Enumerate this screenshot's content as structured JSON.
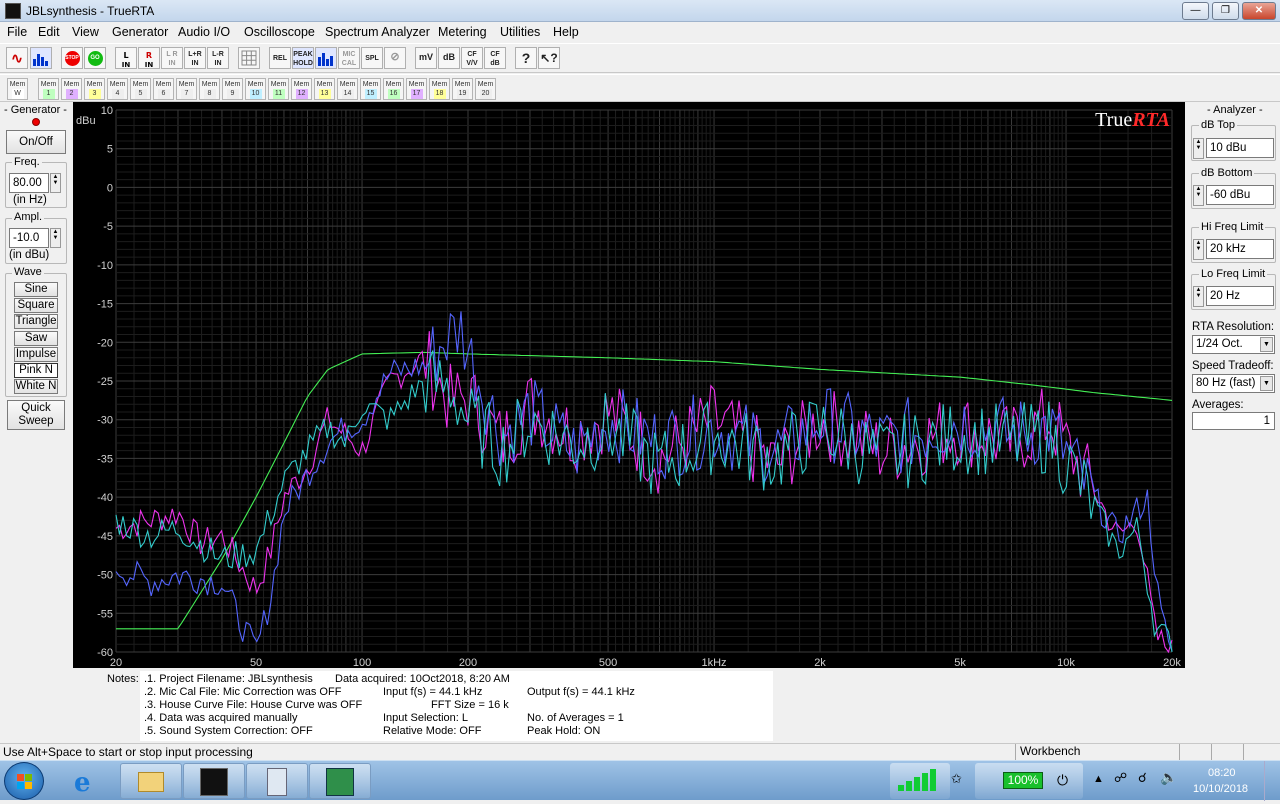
{
  "window": {
    "title": "JBLsynthesis - TrueRTA"
  },
  "menu": [
    "File",
    "Edit",
    "View",
    "Generator",
    "Audio I/O",
    "Oscilloscope",
    "Spectrum Analyzer",
    "Metering",
    "Utilities",
    "Help"
  ],
  "toolbar": {
    "buttons": [
      "L\nIN",
      "R\nIN",
      "L\nIN",
      "L+R\nIN",
      "L-R\nIN",
      "REL",
      "PEAK\nHOLD",
      "MIC\nCAL",
      "SPL",
      "mV",
      "dB",
      "CF\nV/V",
      "CF\ndB",
      "?"
    ],
    "mem_labels": [
      "W",
      "1",
      "2",
      "3",
      "4",
      "5",
      "6",
      "7",
      "8",
      "9",
      "10",
      "11",
      "12",
      "13",
      "14",
      "15",
      "16",
      "17",
      "18",
      "19",
      "20"
    ],
    "mem_prefix": "Mem"
  },
  "generator": {
    "title": "- Generator -",
    "onoff": "On/Off",
    "freq_title": "Freq.",
    "freq_value": "80.00",
    "freq_unit": "(in Hz)",
    "ampl_title": "Ampl.",
    "ampl_value": "-10.0",
    "ampl_unit": "(in dBu)",
    "wave_title": "Wave",
    "waves": [
      "Sine",
      "Square",
      "Triangle",
      "Saw",
      "Impulse",
      "Pink N",
      "White N"
    ],
    "quick_sweep": [
      "Quick",
      "Sweep"
    ]
  },
  "analyzer": {
    "title": "- Analyzer -",
    "db_top_title": "dB Top",
    "db_top": "10 dBu",
    "db_bottom_title": "dB Bottom",
    "db_bottom": "-60 dBu",
    "hi_title": "Hi Freq Limit",
    "hi": "20 kHz",
    "lo_title": "Lo Freq Limit",
    "lo": "20 Hz",
    "res_title": "RTA Resolution:",
    "res": "1/24 Oct.",
    "speed_title": "Speed Tradeoff:",
    "speed": "80 Hz (fast)",
    "avg_title": "Averages:",
    "avg": "1"
  },
  "chart_data": {
    "type": "line",
    "logo": {
      "a": "True",
      "b": "RTA"
    },
    "ylabel": "dBu",
    "ylim": [
      -60,
      10
    ],
    "xlim": [
      20,
      20000
    ],
    "x_scale": "log",
    "grid": true,
    "yticks": [
      "10",
      "5",
      "0",
      "-5",
      "-10",
      "-15",
      "-20",
      "-25",
      "-30",
      "-35",
      "-40",
      "-45",
      "-50",
      "-55",
      "-60"
    ],
    "xticks": [
      {
        "v": 20,
        "t": "20"
      },
      {
        "v": 50,
        "t": "50"
      },
      {
        "v": 100,
        "t": "100"
      },
      {
        "v": 200,
        "t": "200"
      },
      {
        "v": 500,
        "t": "500"
      },
      {
        "v": 1000,
        "t": "1kHz"
      },
      {
        "v": 2000,
        "t": "2k"
      },
      {
        "v": 5000,
        "t": "5k"
      },
      {
        "v": 10000,
        "t": "10k"
      },
      {
        "v": 20000,
        "t": "20k"
      }
    ],
    "series": [
      {
        "color": "#44ee55",
        "smooth": true,
        "points": [
          [
            20,
            -57
          ],
          [
            30,
            -57
          ],
          [
            40,
            -48
          ],
          [
            50,
            -40
          ],
          [
            60,
            -33
          ],
          [
            70,
            -27
          ],
          [
            80,
            -23.5
          ],
          [
            100,
            -21.5
          ],
          [
            150,
            -21.3
          ],
          [
            200,
            -21.5
          ],
          [
            500,
            -22
          ],
          [
            1000,
            -22.5
          ],
          [
            2000,
            -23.5
          ],
          [
            5000,
            -24.5
          ],
          [
            8000,
            -25.5
          ],
          [
            12000,
            -26.5
          ],
          [
            20000,
            -27.5
          ]
        ]
      },
      {
        "color": "#ee33ee",
        "smooth": false,
        "points": [
          [
            20,
            -44
          ],
          [
            25,
            -43
          ],
          [
            30,
            -42
          ],
          [
            35,
            -46
          ],
          [
            40,
            -45
          ],
          [
            50,
            -52
          ],
          [
            55,
            -47
          ],
          [
            60,
            -40
          ],
          [
            70,
            -36
          ],
          [
            80,
            -30
          ],
          [
            90,
            -32
          ],
          [
            100,
            -34
          ],
          [
            120,
            -25
          ],
          [
            150,
            -22
          ],
          [
            180,
            -28
          ],
          [
            200,
            -27
          ],
          [
            250,
            -33
          ],
          [
            300,
            -28
          ],
          [
            400,
            -32
          ],
          [
            500,
            -29
          ],
          [
            700,
            -35
          ],
          [
            1000,
            -30
          ],
          [
            1500,
            -36
          ],
          [
            2000,
            -30
          ],
          [
            3000,
            -34
          ],
          [
            5000,
            -31
          ],
          [
            7000,
            -33
          ],
          [
            9000,
            -30
          ],
          [
            12000,
            -39
          ],
          [
            14000,
            -45
          ],
          [
            16000,
            -43
          ],
          [
            18000,
            -58
          ],
          [
            20000,
            -60
          ]
        ]
      },
      {
        "color": "#5566ff",
        "smooth": false,
        "points": [
          [
            20,
            -49
          ],
          [
            25,
            -51
          ],
          [
            30,
            -50
          ],
          [
            40,
            -51
          ],
          [
            45,
            -56
          ],
          [
            50,
            -60
          ],
          [
            55,
            -53
          ],
          [
            60,
            -42
          ],
          [
            70,
            -37
          ],
          [
            80,
            -33
          ],
          [
            90,
            -31
          ],
          [
            100,
            -30
          ],
          [
            120,
            -24
          ],
          [
            150,
            -23
          ],
          [
            170,
            -20
          ],
          [
            190,
            -18
          ],
          [
            220,
            -26
          ],
          [
            250,
            -32
          ],
          [
            300,
            -29
          ],
          [
            400,
            -34
          ],
          [
            500,
            -30
          ],
          [
            700,
            -33
          ],
          [
            1000,
            -31
          ],
          [
            1500,
            -34
          ],
          [
            2000,
            -30
          ],
          [
            3000,
            -33
          ],
          [
            5000,
            -30
          ],
          [
            7000,
            -32
          ],
          [
            9000,
            -31
          ],
          [
            12000,
            -40
          ],
          [
            14000,
            -45
          ],
          [
            17000,
            -40
          ],
          [
            18500,
            -55
          ],
          [
            20000,
            -60
          ]
        ]
      },
      {
        "color": "#33cccc",
        "smooth": false,
        "points": [
          [
            20,
            -43
          ],
          [
            25,
            -45
          ],
          [
            30,
            -44
          ],
          [
            40,
            -48
          ],
          [
            50,
            -47
          ],
          [
            60,
            -38
          ],
          [
            70,
            -34
          ],
          [
            80,
            -31
          ],
          [
            90,
            -33
          ],
          [
            100,
            -28
          ],
          [
            120,
            -30
          ],
          [
            150,
            -25
          ],
          [
            180,
            -26
          ],
          [
            200,
            -30
          ],
          [
            250,
            -34
          ],
          [
            300,
            -30
          ],
          [
            400,
            -33
          ],
          [
            500,
            -31
          ],
          [
            700,
            -36
          ],
          [
            1000,
            -32
          ],
          [
            1500,
            -35
          ],
          [
            2000,
            -31
          ],
          [
            3000,
            -35
          ],
          [
            5000,
            -32
          ],
          [
            7000,
            -33
          ],
          [
            9000,
            -32
          ],
          [
            12000,
            -41
          ],
          [
            14000,
            -47
          ],
          [
            16000,
            -44
          ],
          [
            18000,
            -57
          ],
          [
            20000,
            -59
          ]
        ]
      }
    ]
  },
  "notes": {
    "label": "Notes:",
    "lines": [
      ".1. Project Filename: JBLsynthesis",
      ".2. Mic Cal File: Mic Correction was OFF",
      ".3. House Curve File: House Curve was OFF",
      ".4. Data was acquired manually",
      ".5. Sound System Correction: OFF"
    ],
    "data_acquired": "Data acquired: 10Oct2018, 8:20 AM",
    "input_fs": "Input f(s) = 44.1 kHz",
    "output_fs": "Output f(s) = 44.1 kHz",
    "fft_size": "FFT Size = 16 k",
    "input_selection": "Input Selection: L",
    "num_averages": "No. of Averages = 1",
    "relative_mode": "Relative Mode:  OFF",
    "peak_hold": "Peak Hold: ON"
  },
  "status": {
    "hint": "Use Alt+Space to start or stop input processing",
    "panel": "Workbench"
  },
  "taskbar": {
    "battery": "100%",
    "time": "08:20",
    "date": "10/10/2018"
  }
}
